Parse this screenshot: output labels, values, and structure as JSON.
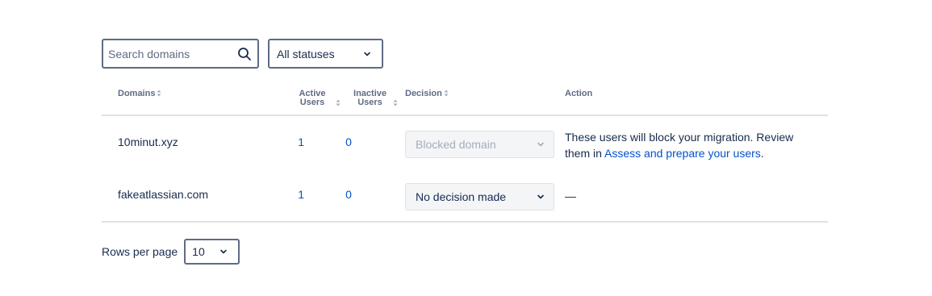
{
  "filters": {
    "search_placeholder": "Search domains",
    "status_value": "All statuses"
  },
  "table": {
    "headers": {
      "domains": "Domains",
      "active_users": "Active\nUsers",
      "inactive_users": "Inactive\nUsers",
      "decision": "Decision",
      "action": "Action"
    },
    "rows": [
      {
        "domain": "10minut.xyz",
        "active": "1",
        "inactive": "0",
        "decision": "Blocked domain",
        "action_text": "These users will block your migration. Review them in ",
        "action_link": "Assess and prepare your users",
        "action_suffix": "."
      },
      {
        "domain": "fakeatlassian.com",
        "active": "1",
        "inactive": "0",
        "decision": "No decision made",
        "action_text": "—"
      }
    ]
  },
  "pagination": {
    "rows_label": "Rows per page",
    "rows_value": "10"
  },
  "colors": {
    "link": "#0052cc",
    "text": "#172b4d",
    "muted": "#5e6c84",
    "border": "#dfe1e6"
  }
}
